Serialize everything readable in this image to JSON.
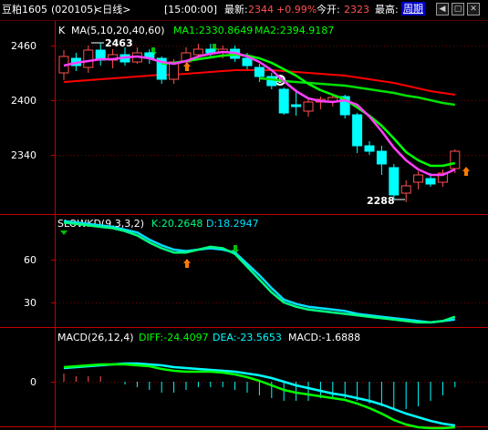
{
  "header": {
    "symbol": "豆粕1605",
    "code": "(020105)",
    "period": "<日线>",
    "time": "[15:00:00]",
    "latest_label": "最新:",
    "latest": "2344",
    "change_pct": "+0.99%",
    "open_label": "今开:",
    "open": "2323",
    "high_label": "最高:",
    "period_link": "周期",
    "win_buttons": [
      "prev-icon",
      "restore-icon",
      "close-icon"
    ]
  },
  "colors": {
    "up": "#ff5050",
    "down": "#00ffff",
    "bull_fill": "#000000",
    "ma1": "#00ff00",
    "ma2": "#00ff00",
    "ma_short": "#ff40ff",
    "base": "#ff0000",
    "axis": "#c00000",
    "grid_dot": "#7a0000",
    "text": "#ffffff",
    "kd_k": "#00ff80",
    "kd_d": "#00e0ff",
    "dif": "#00ff00",
    "dea": "#00ffff"
  },
  "panels": {
    "price": {
      "ind_name": "K",
      "ma_name": "MA(5,10,20,40,60)",
      "ma1_label": "MA1:2330.8649",
      "ma2_label": "MA2:2394.9187",
      "ticks": [
        "2460",
        "2400",
        "2340"
      ],
      "high_label": "2463",
      "low_label": "2288"
    },
    "kd": {
      "name": "SLOWKD(9,3,3,2)",
      "k_label": "K:20.2648",
      "d_label": "D:18.2947",
      "ticks": [
        "60",
        "30"
      ]
    },
    "macd": {
      "name": "MACD(26,12,4)",
      "dif_label": "DIFF:-24.4097",
      "dea_label": "DEA:-23.5653",
      "macd_label": "MACD:-1.6888",
      "ticks": [
        "0"
      ]
    }
  },
  "chart_data": {
    "type": "candlestick",
    "price_ylim": [
      2280,
      2480
    ],
    "candles": [
      {
        "o": 2430,
        "h": 2455,
        "l": 2422,
        "c": 2448
      },
      {
        "o": 2446,
        "h": 2452,
        "l": 2432,
        "c": 2438
      },
      {
        "o": 2436,
        "h": 2460,
        "l": 2430,
        "c": 2455
      },
      {
        "o": 2455,
        "h": 2463,
        "l": 2438,
        "c": 2444
      },
      {
        "o": 2444,
        "h": 2456,
        "l": 2435,
        "c": 2450
      },
      {
        "o": 2450,
        "h": 2458,
        "l": 2438,
        "c": 2442
      },
      {
        "o": 2442,
        "h": 2458,
        "l": 2440,
        "c": 2452
      },
      {
        "o": 2452,
        "h": 2456,
        "l": 2440,
        "c": 2446
      },
      {
        "o": 2446,
        "h": 2448,
        "l": 2418,
        "c": 2423
      },
      {
        "o": 2423,
        "h": 2445,
        "l": 2418,
        "c": 2442
      },
      {
        "o": 2442,
        "h": 2458,
        "l": 2438,
        "c": 2452
      },
      {
        "o": 2450,
        "h": 2462,
        "l": 2446,
        "c": 2456
      },
      {
        "o": 2456,
        "h": 2462,
        "l": 2448,
        "c": 2452
      },
      {
        "o": 2452,
        "h": 2460,
        "l": 2446,
        "c": 2456
      },
      {
        "o": 2456,
        "h": 2460,
        "l": 2442,
        "c": 2446
      },
      {
        "o": 2446,
        "h": 2452,
        "l": 2434,
        "c": 2438
      },
      {
        "o": 2436,
        "h": 2440,
        "l": 2420,
        "c": 2426
      },
      {
        "o": 2426,
        "h": 2430,
        "l": 2412,
        "c": 2416
      },
      {
        "o": 2412,
        "h": 2414,
        "l": 2384,
        "c": 2386
      },
      {
        "o": 2395,
        "h": 2412,
        "l": 2383,
        "c": 2393
      },
      {
        "o": 2388,
        "h": 2402,
        "l": 2382,
        "c": 2398
      },
      {
        "o": 2398,
        "h": 2404,
        "l": 2390,
        "c": 2401
      },
      {
        "o": 2399,
        "h": 2405,
        "l": 2393,
        "c": 2403
      },
      {
        "o": 2404,
        "h": 2406,
        "l": 2380,
        "c": 2384
      },
      {
        "o": 2384,
        "h": 2386,
        "l": 2342,
        "c": 2350
      },
      {
        "o": 2350,
        "h": 2355,
        "l": 2340,
        "c": 2344
      },
      {
        "o": 2344,
        "h": 2350,
        "l": 2318,
        "c": 2330
      },
      {
        "o": 2326,
        "h": 2330,
        "l": 2290,
        "c": 2296
      },
      {
        "o": 2298,
        "h": 2312,
        "l": 2288,
        "c": 2306
      },
      {
        "o": 2310,
        "h": 2322,
        "l": 2302,
        "c": 2318
      },
      {
        "o": 2314,
        "h": 2320,
        "l": 2305,
        "c": 2308
      },
      {
        "o": 2310,
        "h": 2324,
        "l": 2305,
        "c": 2320
      },
      {
        "o": 2325,
        "h": 2346,
        "l": 2320,
        "c": 2344
      }
    ],
    "ma1": [
      null,
      null,
      null,
      null,
      null,
      null,
      null,
      null,
      2440,
      2441,
      2443,
      2445,
      2447,
      2449,
      2450,
      2449,
      2446,
      2441,
      2434,
      2427,
      2418,
      2411,
      2406,
      2401,
      2392,
      2383,
      2372,
      2358,
      2343,
      2334,
      2328,
      2328,
      2331
    ],
    "ma2": [
      null,
      null,
      null,
      null,
      null,
      null,
      null,
      null,
      null,
      null,
      null,
      null,
      null,
      null,
      null,
      null,
      2424,
      2423,
      2421,
      2420,
      2419,
      2418,
      2417,
      2416,
      2414,
      2412,
      2410,
      2408,
      2405,
      2403,
      2400,
      2397,
      2395
    ],
    "ma_short": [
      2438,
      2441,
      2443,
      2445,
      2445,
      2447,
      2448,
      2446,
      2442,
      2440,
      2443,
      2448,
      2451,
      2453,
      2452,
      2448,
      2442,
      2433,
      2421,
      2410,
      2402,
      2399,
      2398,
      2400,
      2395,
      2382,
      2366,
      2348,
      2334,
      2324,
      2318,
      2318,
      2324
    ],
    "base": [
      2420,
      2421,
      2422,
      2423,
      2424,
      2425,
      2426,
      2427,
      2428,
      2428,
      2429,
      2430,
      2431,
      2432,
      2433,
      2433,
      2433,
      2433,
      2432,
      2431,
      2430,
      2429,
      2428,
      2427,
      2425,
      2423,
      2421,
      2419,
      2416,
      2413,
      2410,
      2408,
      2406
    ],
    "kd_ylim": [
      10,
      90
    ],
    "k": [
      86,
      85,
      84,
      83,
      82,
      80,
      77,
      72,
      68,
      65,
      65,
      67,
      69,
      68,
      64,
      55,
      46,
      37,
      30,
      27,
      25,
      24,
      23,
      22,
      21,
      20,
      19,
      18,
      17,
      16,
      16,
      17,
      20
    ],
    "d": [
      87,
      86,
      85,
      84,
      83,
      81,
      79,
      74,
      70,
      67,
      66,
      67,
      68,
      67,
      65,
      57,
      49,
      40,
      32,
      29,
      27,
      26,
      25,
      24,
      22,
      21,
      20,
      19,
      18,
      17,
      16,
      17,
      18
    ],
    "macd_ylim": [
      -60,
      30
    ],
    "dif": [
      16,
      17,
      18,
      19,
      19,
      19,
      18,
      17,
      14,
      12,
      11,
      11,
      11,
      10,
      8,
      5,
      1,
      -4,
      -9,
      -12,
      -14,
      -16,
      -18,
      -20,
      -24,
      -29,
      -35,
      -42,
      -47,
      -50,
      -51,
      -51,
      -50
    ],
    "dea": [
      15,
      16,
      17,
      18,
      19,
      20,
      20,
      19,
      18,
      16,
      15,
      14,
      13,
      12,
      11,
      9,
      7,
      4,
      0,
      -4,
      -7,
      -10,
      -13,
      -15,
      -18,
      -21,
      -25,
      -30,
      -35,
      -39,
      -43,
      -46,
      -48
    ],
    "macd_hist": [
      3,
      2,
      2,
      2,
      0,
      -1,
      -2,
      -3,
      -4,
      -4,
      -3,
      -2,
      -2,
      -2,
      -3,
      -4,
      -5,
      -6,
      -7,
      -7,
      -7,
      -6,
      -6,
      -6,
      -7,
      -8,
      -9,
      -10,
      -10,
      -9,
      -7,
      -5,
      -2
    ]
  }
}
